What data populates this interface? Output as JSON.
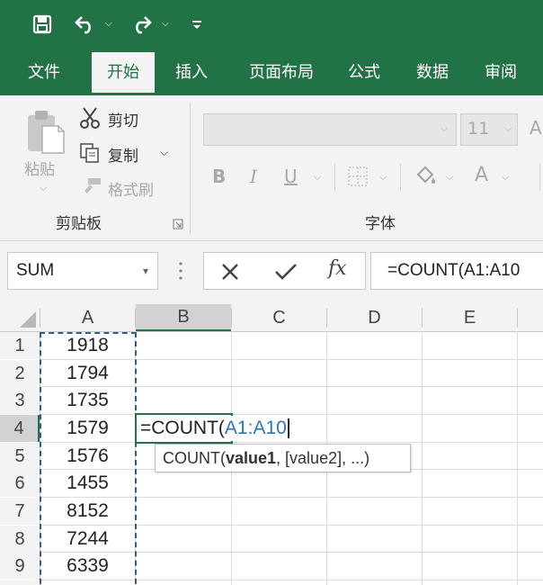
{
  "quick_access": {
    "save": "save-icon",
    "undo": "undo-icon",
    "redo": "redo-icon",
    "customize": "customize-icon"
  },
  "tabs": [
    "文件",
    "开始",
    "插入",
    "页面布局",
    "公式",
    "数据",
    "审阅"
  ],
  "ribbon": {
    "paste_label": "粘贴",
    "cut_label": "剪切",
    "copy_label": "复制",
    "format_painter_label": "格式刷",
    "clipboard_group": "剪贴板",
    "font_size": "11",
    "font_group": "字体",
    "bold": "B",
    "italic": "I",
    "underline": "U",
    "font_color": "A"
  },
  "formula_bar": {
    "name_box": "SUM",
    "formula": "=COUNT(A1:A10",
    "fx": "fx"
  },
  "grid": {
    "columns": [
      "A",
      "B",
      "C",
      "D",
      "E"
    ],
    "rows": [
      "1",
      "2",
      "3",
      "4",
      "5",
      "6",
      "7",
      "8",
      "9"
    ],
    "column_a_values": [
      "1918",
      "1794",
      "1735",
      "1579",
      "1576",
      "1455",
      "8152",
      "7244",
      "6339"
    ],
    "editing_cell": {
      "prefix": "=COUNT(",
      "range": "A1:A10"
    },
    "tooltip": {
      "func": "COUNT(",
      "arg1": "value1",
      "rest": ", [value2], ...)"
    }
  },
  "colors": {
    "excel_green": "#217346",
    "range_blue": "#2e75b6",
    "ribbon_bg": "#f3f3f3"
  }
}
